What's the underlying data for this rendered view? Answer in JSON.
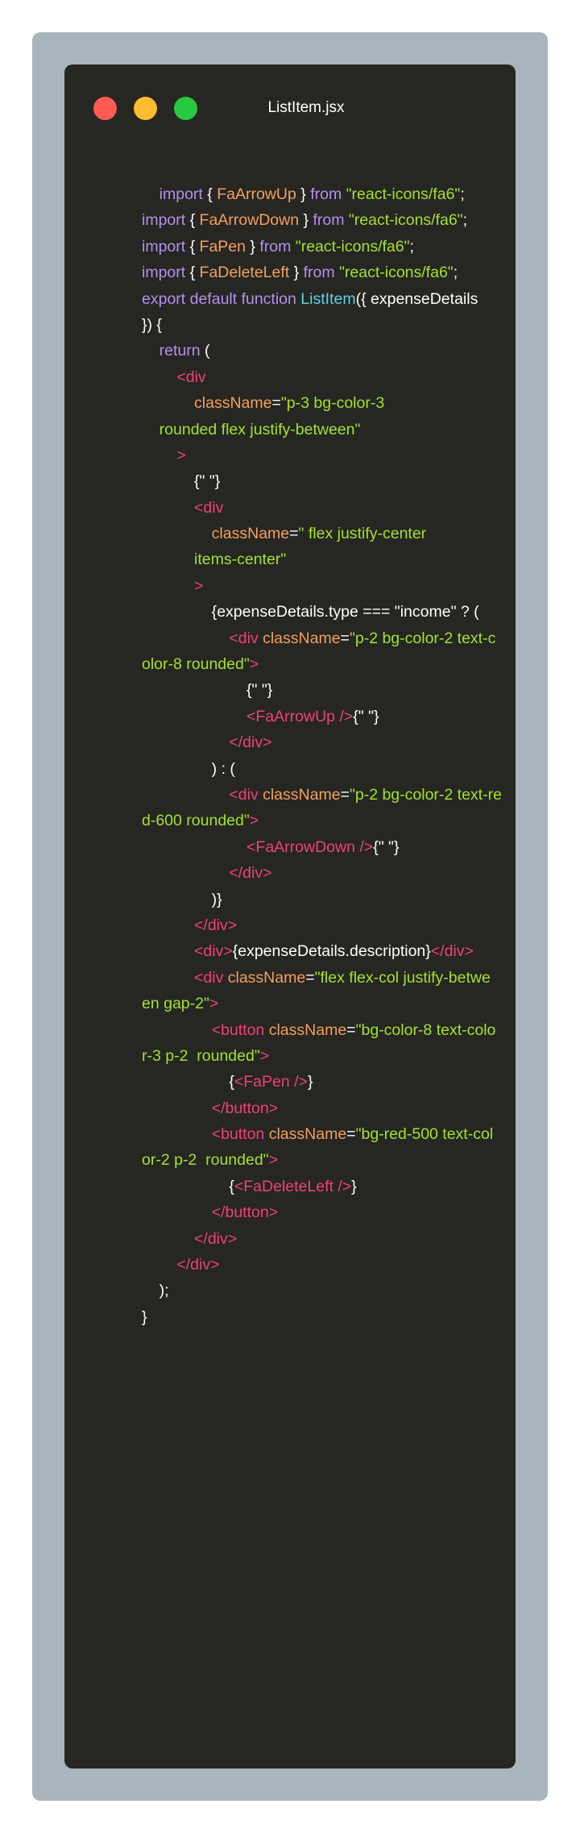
{
  "window": {
    "title": "ListItem.jsx",
    "traffic_lights": [
      "close",
      "minimize",
      "maximize"
    ],
    "colors": {
      "background": "#262622",
      "frame": "#a9b4bc",
      "close": "#ff5b55",
      "minimize": "#febc2e",
      "maximize": "#28c840"
    }
  },
  "code": {
    "lines": [
      [
        {
          "c": "k",
          "t": "    import"
        },
        {
          "c": "w",
          "t": " { "
        },
        {
          "c": "v",
          "t": "FaArrowUp"
        },
        {
          "c": "w",
          "t": " } "
        },
        {
          "c": "k",
          "t": "from"
        },
        {
          "c": "s",
          "t": " \"react-icons/fa6\""
        },
        {
          "c": "w",
          "t": ";"
        }
      ],
      [
        {
          "c": "k",
          "t": "import"
        },
        {
          "c": "w",
          "t": " { "
        },
        {
          "c": "v",
          "t": "FaArrowDown"
        },
        {
          "c": "w",
          "t": " } "
        },
        {
          "c": "k",
          "t": "from"
        },
        {
          "c": "s",
          "t": " \"react-icons/fa6\""
        },
        {
          "c": "w",
          "t": ";"
        }
      ],
      [
        {
          "c": "k",
          "t": "import"
        },
        {
          "c": "w",
          "t": " { "
        },
        {
          "c": "v",
          "t": "FaPen"
        },
        {
          "c": "w",
          "t": " } "
        },
        {
          "c": "k",
          "t": "from"
        },
        {
          "c": "s",
          "t": " \"react-icons/fa6\""
        },
        {
          "c": "w",
          "t": ";"
        }
      ],
      [
        {
          "c": "k",
          "t": "import"
        },
        {
          "c": "w",
          "t": " { "
        },
        {
          "c": "v",
          "t": "FaDeleteLeft"
        },
        {
          "c": "w",
          "t": " } "
        },
        {
          "c": "k",
          "t": "from"
        },
        {
          "c": "s",
          "t": " \"react-icons/fa6\""
        },
        {
          "c": "w",
          "t": ";"
        }
      ],
      [
        {
          "c": "k",
          "t": "export default function "
        },
        {
          "c": "f",
          "t": "ListItem"
        },
        {
          "c": "w",
          "t": "({ expenseDetails"
        }
      ],
      [
        {
          "c": "w",
          "t": "}) {"
        }
      ],
      [
        {
          "c": "k",
          "t": "    return"
        },
        {
          "c": "w",
          "t": " ("
        }
      ],
      [
        {
          "c": "t",
          "t": "        <div"
        }
      ],
      [
        {
          "c": "v",
          "t": "            className"
        },
        {
          "c": "w",
          "t": "="
        },
        {
          "c": "s",
          "t": "\"p-3 bg-color-3"
        }
      ],
      [
        {
          "c": "s",
          "t": "    rounded flex justify-between\""
        }
      ],
      [
        {
          "c": "t",
          "t": "        >"
        }
      ],
      [
        {
          "c": "w",
          "t": "            {\" \"}"
        }
      ],
      [
        {
          "c": "t",
          "t": "            <div"
        }
      ],
      [
        {
          "c": "v",
          "t": "                className"
        },
        {
          "c": "w",
          "t": "="
        },
        {
          "c": "s",
          "t": "\" flex justify-center"
        }
      ],
      [
        {
          "c": "s",
          "t": "            items-center\""
        }
      ],
      [
        {
          "c": "t",
          "t": "            >"
        }
      ],
      [
        {
          "c": "w",
          "t": "                {expenseDetails.type === \"income\" ? ("
        }
      ],
      [
        {
          "c": "t",
          "t": "                    <div"
        },
        {
          "c": "v",
          "t": " className"
        },
        {
          "c": "w",
          "t": "="
        },
        {
          "c": "s",
          "t": "\"p-2 bg-color-2 text-c"
        }
      ],
      [
        {
          "c": "s",
          "t": "olor-8 rounded\""
        },
        {
          "c": "t",
          "t": ">"
        }
      ],
      [
        {
          "c": "w",
          "t": "                        {\" \"}"
        }
      ],
      [
        {
          "c": "t",
          "t": "                        <FaArrowUp"
        },
        {
          "c": "t",
          "t": " />"
        },
        {
          "c": "w",
          "t": "{\" \"}"
        }
      ],
      [
        {
          "c": "t",
          "t": "                    </div>"
        }
      ],
      [
        {
          "c": "w",
          "t": "                ) : ("
        }
      ],
      [
        {
          "c": "t",
          "t": "                    <div"
        },
        {
          "c": "v",
          "t": " className"
        },
        {
          "c": "w",
          "t": "="
        },
        {
          "c": "s",
          "t": "\"p-2 bg-color-2 text-re"
        }
      ],
      [
        {
          "c": "s",
          "t": "d-600 rounded\""
        },
        {
          "c": "t",
          "t": ">"
        }
      ],
      [
        {
          "c": "t",
          "t": "                        <FaArrowDown"
        },
        {
          "c": "t",
          "t": " />"
        },
        {
          "c": "w",
          "t": "{\" \"}"
        }
      ],
      [
        {
          "c": "t",
          "t": "                    </div>"
        }
      ],
      [
        {
          "c": "w",
          "t": "                )}"
        }
      ],
      [
        {
          "c": "t",
          "t": "            </div>"
        }
      ],
      [
        {
          "c": "t",
          "t": "            <div>"
        },
        {
          "c": "w",
          "t": "{expenseDetails.description}"
        },
        {
          "c": "t",
          "t": "</div>"
        }
      ],
      [
        {
          "c": "t",
          "t": "            <div"
        },
        {
          "c": "v",
          "t": " className"
        },
        {
          "c": "w",
          "t": "="
        },
        {
          "c": "s",
          "t": "\"flex flex-col justify-betwe"
        }
      ],
      [
        {
          "c": "s",
          "t": "en gap-2\""
        },
        {
          "c": "t",
          "t": ">"
        }
      ],
      [
        {
          "c": "t",
          "t": "                <button"
        },
        {
          "c": "v",
          "t": " className"
        },
        {
          "c": "w",
          "t": "="
        },
        {
          "c": "s",
          "t": "\"bg-color-8 text-colo"
        }
      ],
      [
        {
          "c": "s",
          "t": "r-3 p-2  rounded\""
        },
        {
          "c": "t",
          "t": ">"
        }
      ],
      [
        {
          "c": "w",
          "t": "                    {"
        },
        {
          "c": "t",
          "t": "<FaPen"
        },
        {
          "c": "t",
          "t": " />"
        },
        {
          "c": "w",
          "t": "}"
        }
      ],
      [
        {
          "c": "t",
          "t": "                </button>"
        }
      ],
      [
        {
          "c": "t",
          "t": "                <button"
        },
        {
          "c": "v",
          "t": " className"
        },
        {
          "c": "w",
          "t": "="
        },
        {
          "c": "s",
          "t": "\"bg-red-500 text-col"
        }
      ],
      [
        {
          "c": "s",
          "t": "or-2 p-2  rounded\""
        },
        {
          "c": "t",
          "t": ">"
        }
      ],
      [
        {
          "c": "w",
          "t": "                    {"
        },
        {
          "c": "t",
          "t": "<FaDeleteLeft"
        },
        {
          "c": "t",
          "t": " />"
        },
        {
          "c": "w",
          "t": "}"
        }
      ],
      [
        {
          "c": "t",
          "t": "                </button>"
        }
      ],
      [
        {
          "c": "t",
          "t": "            </div>"
        }
      ],
      [
        {
          "c": "t",
          "t": "        </div>"
        }
      ],
      [
        {
          "c": "w",
          "t": "    );"
        }
      ],
      [
        {
          "c": "w",
          "t": "}"
        }
      ]
    ]
  }
}
